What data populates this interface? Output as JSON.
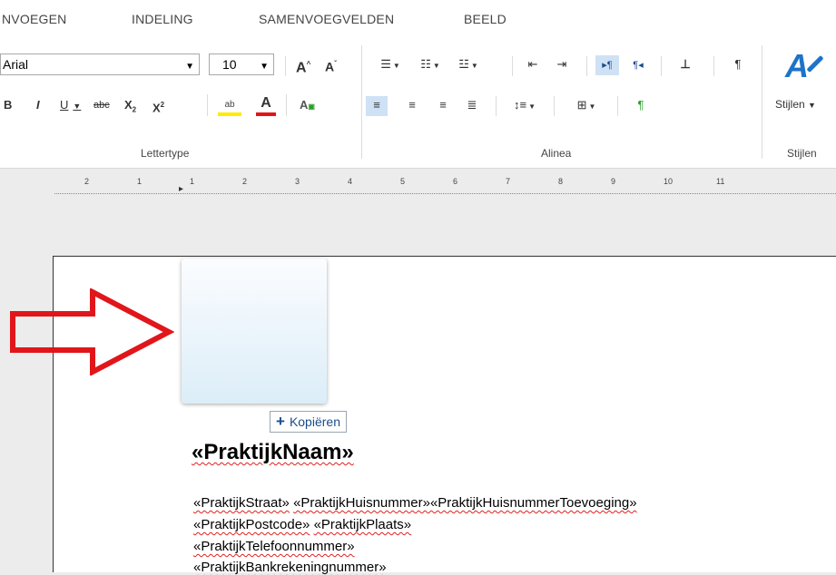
{
  "tabs": {
    "insert": "NVOEGEN",
    "layout": "INDELING",
    "mail_merge": "SAMENVOEGVELDEN",
    "view": "BEELD"
  },
  "font": {
    "family": "Arial",
    "size": "10",
    "grow": "A",
    "shrink": "A",
    "bold": "B",
    "italic": "I",
    "underline": "U",
    "strike": "abc",
    "sub": "X",
    "sup": "X",
    "highlight": "ab",
    "color": "A",
    "clear": "A"
  },
  "groups": {
    "font": "Lettertype",
    "paragraph": "Alinea",
    "styles": "Stijlen"
  },
  "styles_btn": {
    "label": "Stijlen",
    "icon_letter": "A"
  },
  "paragraph": {
    "pilcrow": "¶"
  },
  "ruler": {
    "labels": [
      "2",
      "1",
      "1",
      "2",
      "3",
      "4",
      "5",
      "6",
      "7",
      "8",
      "9",
      "10",
      "11"
    ]
  },
  "document": {
    "copy_button": "Kopiëren",
    "copy_symbol": "+",
    "title": "«PraktijkNaam»",
    "line1": [
      "«PraktijkStraat»",
      "«PraktijkHuisnummer»«PraktijkHuisnummerToevoeging»"
    ],
    "line2": [
      "«PraktijkPostcode»",
      "«PraktijkPlaats»"
    ],
    "line3": "«PraktijkTelefoonnummer»",
    "line4": "«PraktijkBankrekeningnummer»"
  },
  "colors": {
    "arrow": "#e1161b",
    "highlight": "#ffeb00",
    "font_color": "#e1161b",
    "accent": "#1a4c8b"
  }
}
